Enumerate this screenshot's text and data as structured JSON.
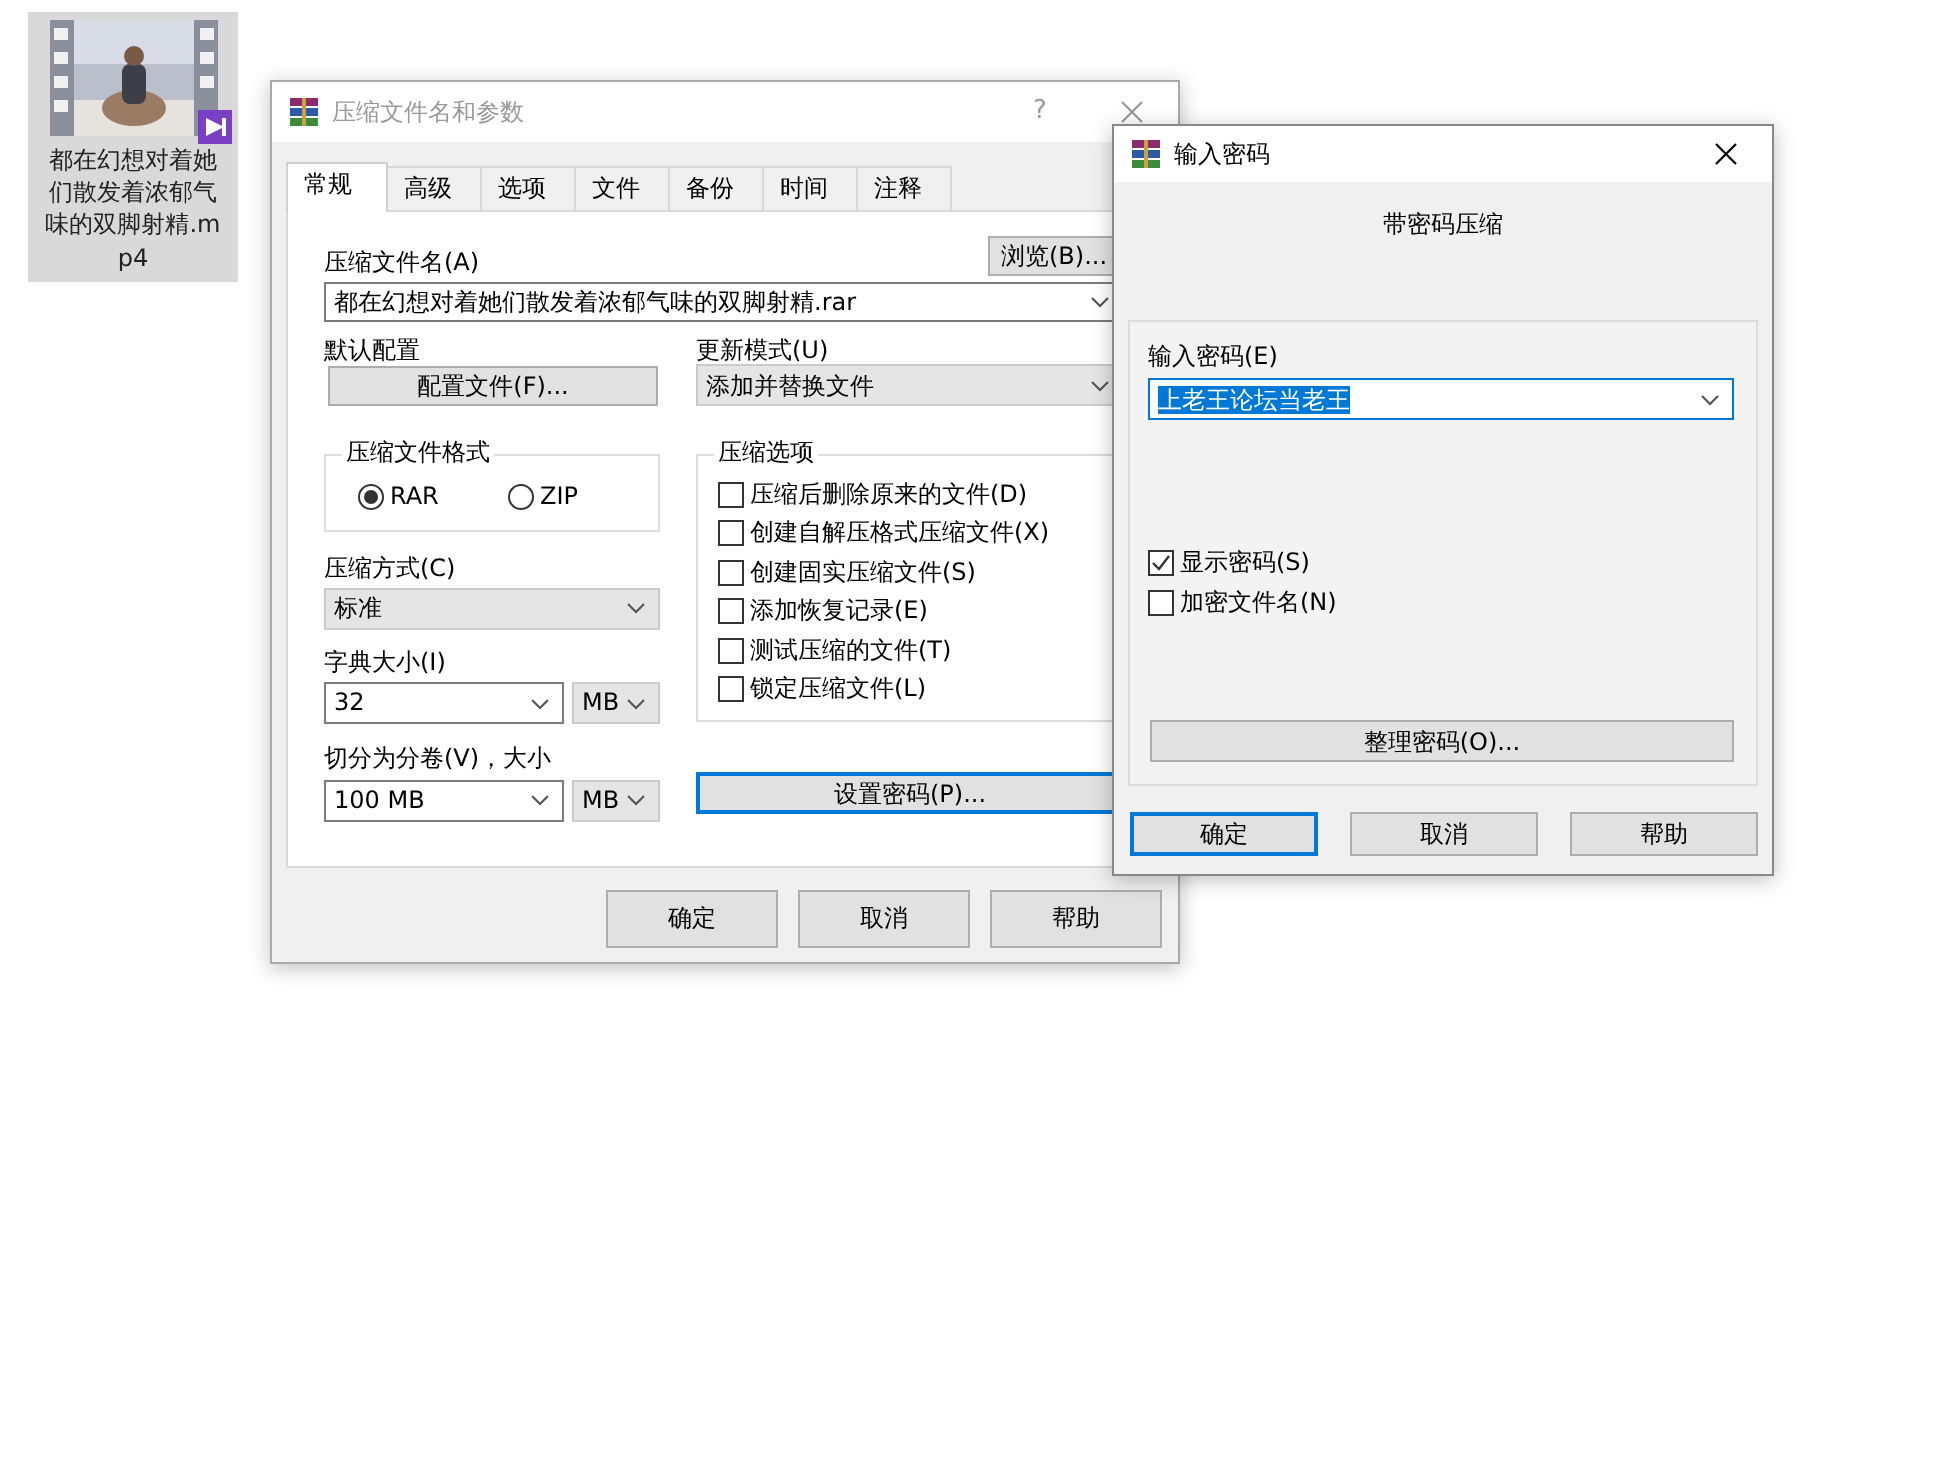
{
  "desktop_icon": {
    "filename": "都在幻想对着她们散发着浓郁气味的双脚射精.mp4",
    "selected": true
  },
  "archive_dialog": {
    "title": "压缩文件名和参数",
    "active": false,
    "help": "?",
    "tabs": [
      {
        "label": "常规",
        "selected": true
      },
      {
        "label": "高级",
        "selected": false
      },
      {
        "label": "选项",
        "selected": false
      },
      {
        "label": "文件",
        "selected": false
      },
      {
        "label": "备份",
        "selected": false
      },
      {
        "label": "时间",
        "selected": false
      },
      {
        "label": "注释",
        "selected": false
      }
    ],
    "archive_name": {
      "label": "压缩文件名(A)",
      "value": "都在幻想对着她们散发着浓郁气味的双脚射精.rar"
    },
    "browse_button": "浏览(B)...",
    "profile": {
      "label": "默认配置",
      "button": "配置文件(F)..."
    },
    "update_mode": {
      "label": "更新模式(U)",
      "value": "添加并替换文件"
    },
    "archive_format": {
      "label": "压缩文件格式",
      "options": [
        {
          "label": "RAR",
          "selected": true
        },
        {
          "label": "ZIP",
          "selected": false
        }
      ]
    },
    "compression_method": {
      "label": "压缩方式(C)",
      "value": "标准"
    },
    "dictionary_size": {
      "label": "字典大小(I)",
      "value": "32",
      "unit": "MB"
    },
    "split_volumes": {
      "label": "切分为分卷(V)，大小",
      "value": "100 MB",
      "unit": "MB"
    },
    "archiving_options": {
      "label": "压缩选项",
      "items": [
        {
          "label": "压缩后删除原来的文件(D)",
          "checked": false
        },
        {
          "label": "创建自解压格式压缩文件(X)",
          "checked": false
        },
        {
          "label": "创建固实压缩文件(S)",
          "checked": false
        },
        {
          "label": "添加恢复记录(E)",
          "checked": false
        },
        {
          "label": "测试压缩的文件(T)",
          "checked": false
        },
        {
          "label": "锁定压缩文件(L)",
          "checked": false
        }
      ]
    },
    "password_button": {
      "label": "设置密码(P)...",
      "focused": true
    },
    "buttons": [
      {
        "label": "确定",
        "focused": false
      },
      {
        "label": "取消",
        "focused": false
      },
      {
        "label": "帮助",
        "focused": false
      }
    ]
  },
  "password_dialog": {
    "title": "输入密码",
    "active": true,
    "heading": "带密码压缩",
    "password": {
      "label": "输入密码(E)",
      "value": "上老王论坛当老王",
      "value_selected": true
    },
    "options": [
      {
        "label": "显示密码(S)",
        "checked": true
      },
      {
        "label": "加密文件名(N)",
        "checked": false
      }
    ],
    "organize_button": "整理密码(O)...",
    "buttons": [
      {
        "label": "确定",
        "focused": true
      },
      {
        "label": "取消",
        "focused": false
      },
      {
        "label": "帮助",
        "focused": false
      }
    ]
  }
}
